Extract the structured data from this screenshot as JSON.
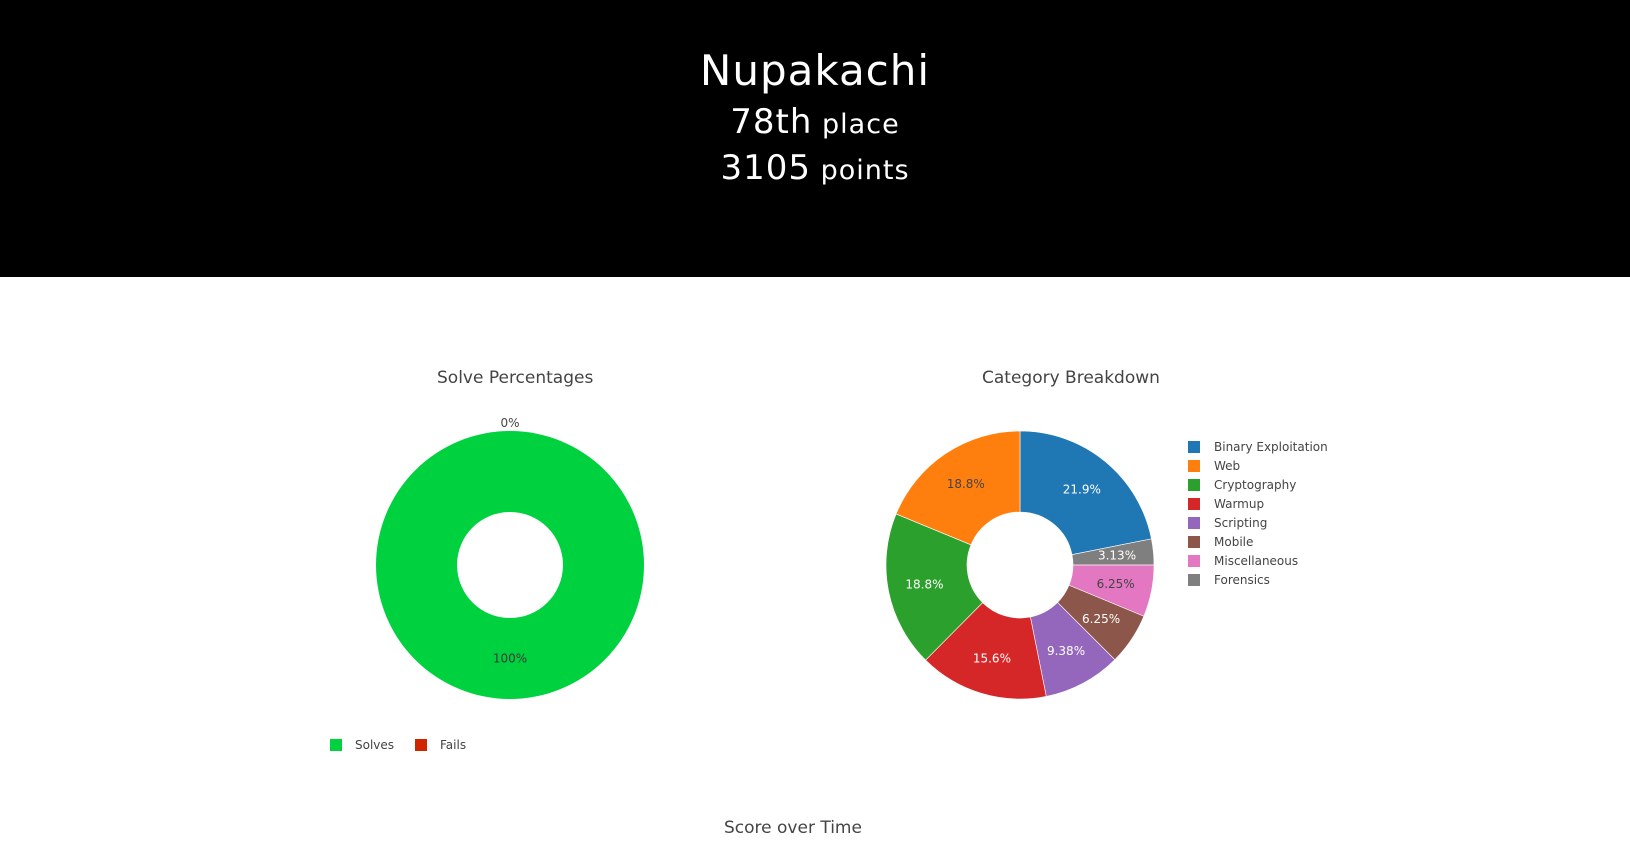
{
  "header": {
    "team_name": "Nupakachi",
    "place_number": "78th",
    "place_word": "place",
    "score_number": "3105",
    "score_word": "points"
  },
  "chart_titles": {
    "solves": "Solve Percentages",
    "categories": "Category Breakdown",
    "score": "Score over Time"
  },
  "chart_data": [
    {
      "type": "pie",
      "title": "Solve Percentages",
      "hole": true,
      "slices": [
        {
          "label": "Solves",
          "value": 100,
          "text": "100%",
          "color": "#00d13f"
        },
        {
          "label": "Fails",
          "value": 0,
          "text": "0%",
          "color": "#cf2600"
        }
      ],
      "legend_placement": "bottom"
    },
    {
      "type": "pie",
      "title": "Category Breakdown",
      "hole": true,
      "slices": [
        {
          "label": "Binary Exploitation",
          "value": 21.9,
          "text": "21.9%",
          "color": "#1f77b4"
        },
        {
          "label": "Forensics",
          "value": 3.13,
          "text": "3.13%",
          "color": "#7f7f7f"
        },
        {
          "label": "Miscellaneous",
          "value": 6.25,
          "text": "6.25%",
          "color": "#e377c2"
        },
        {
          "label": "Mobile",
          "value": 6.25,
          "text": "6.25%",
          "color": "#8c564b"
        },
        {
          "label": "Scripting",
          "value": 9.38,
          "text": "9.38%",
          "color": "#9467bd"
        },
        {
          "label": "Warmup",
          "value": 15.6,
          "text": "15.6%",
          "color": "#d62728"
        },
        {
          "label": "Cryptography",
          "value": 18.8,
          "text": "18.8%",
          "color": "#2ca02c"
        },
        {
          "label": "Web",
          "value": 18.8,
          "text": "18.8%",
          "color": "#ff7f0e"
        }
      ],
      "legend": [
        "Binary Exploitation",
        "Web",
        "Cryptography",
        "Warmup",
        "Scripting",
        "Mobile",
        "Miscellaneous",
        "Forensics"
      ],
      "legend_placement": "right"
    },
    {
      "type": "line",
      "title": "Score over Time"
    }
  ]
}
